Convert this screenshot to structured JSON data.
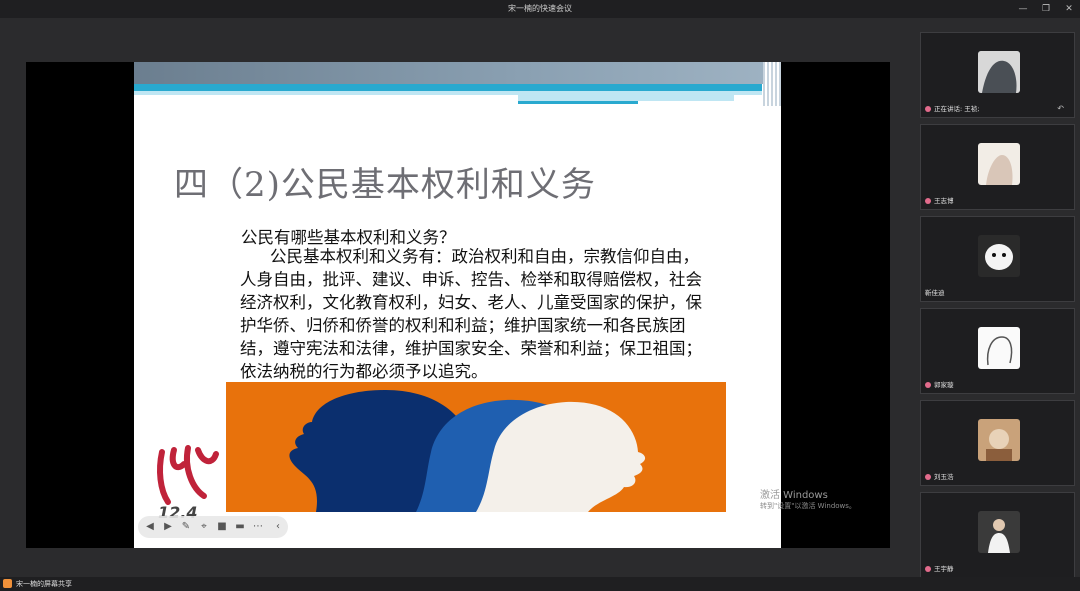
{
  "window": {
    "title": "宋一楠的快速会议",
    "controls": {
      "minimize": "—",
      "restore": "❐",
      "close": "✕"
    }
  },
  "slide": {
    "title": "四（2)公民基本权利和义务",
    "question": "公民有哪些基本权利和义务？",
    "answer": "公民基本权利和义务有：政治权利和自由，宗教信仰自由，人身自由，批评、建议、申诉、控告、检举和取得赔偿权，社会经济权利，文化教育权利，妇女、老人、儿童受国家的保护，保护华侨、归侨和侨誉的权利和利益；维护国家统一和各民族团结，遵守宪法和法律，维护国家安全、荣誉和利益；保卫祖国；依法纳税的行为都必须予以追究。",
    "logo_text": "12.4",
    "colors": {
      "band_dark": "#6b7e8f",
      "band_blue": "#29a9cf",
      "band_light": "#bfe6f3",
      "orange": "#e8720c",
      "logo_red": "#c0233a"
    }
  },
  "slide_toolbar": {
    "icons": [
      "prev-icon",
      "next-icon",
      "pen-icon",
      "pointer-icon",
      "camera-icon",
      "comment-icon",
      "more-icon",
      "collapse-icon"
    ],
    "glyphs": [
      "◀",
      "▶",
      "✎",
      "⌖",
      "■",
      "▬",
      "⋯",
      "‹"
    ]
  },
  "watermark": {
    "line1": "激活 Windows",
    "line2": "转到\"设置\"以激活 Windows。"
  },
  "participants": [
    {
      "name": "正在讲话: 王祯;",
      "speaking": true
    },
    {
      "name": "王志博"
    },
    {
      "name": "靳佳迪"
    },
    {
      "name": "郭家璇"
    },
    {
      "name": "刘玉浩"
    },
    {
      "name": "王宇静"
    }
  ],
  "bottombar": {
    "label": "宋一楠的屏幕共享"
  }
}
